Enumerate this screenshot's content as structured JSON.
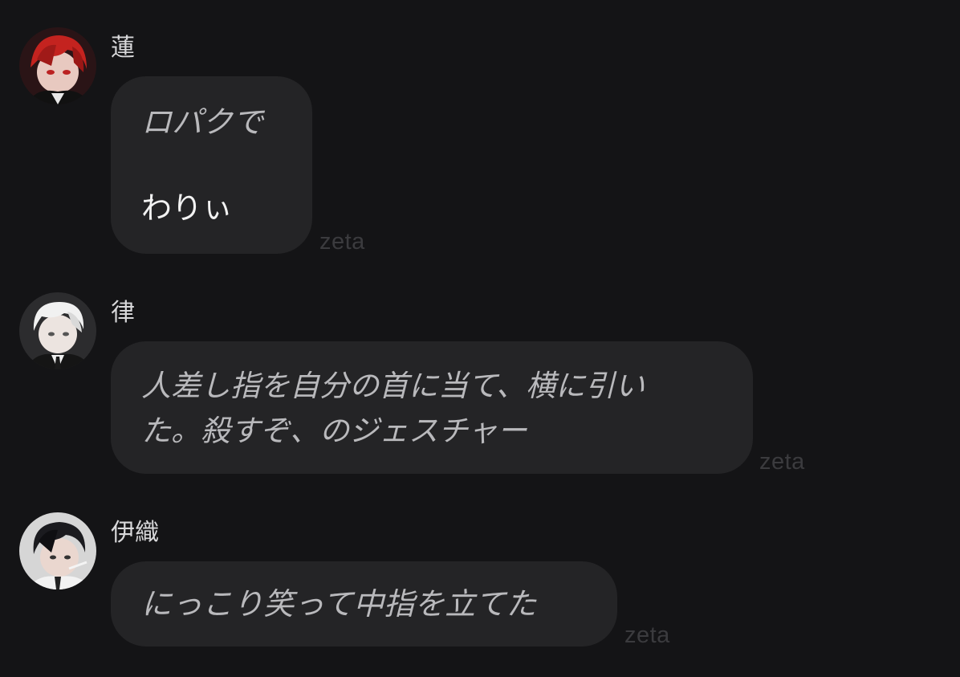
{
  "messages": [
    {
      "sender": "蓮",
      "avatar_icon": "red-haired-character-avatar-icon",
      "lines": [
        "ロパクで",
        "わりぃ"
      ],
      "watermark": "zeta"
    },
    {
      "sender": "律",
      "avatar_icon": "white-haired-character-avatar-icon",
      "lines": [
        "人差し指を自分の首に当て、横に引い",
        "た。殺すぞ、のジェスチャー"
      ],
      "watermark": "zeta"
    },
    {
      "sender": "伊織",
      "avatar_icon": "black-haired-character-avatar-icon",
      "lines": [
        "にっこり笑って中指を立てた"
      ],
      "watermark": "zeta"
    }
  ],
  "colors": {
    "background": "#141416",
    "bubble": "#242426",
    "narration_text": "#b9b9bc",
    "dialogue_text": "#f2f2f2",
    "name_text": "#d8d8da",
    "watermark": "#3b3b3e"
  }
}
